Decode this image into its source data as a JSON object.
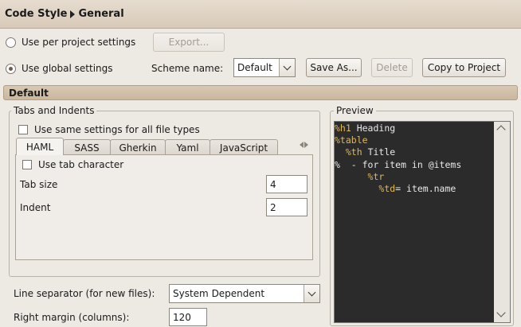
{
  "header": {
    "crumb_parent": "Code Style",
    "crumb_current": "General"
  },
  "scope": {
    "per_project_label": "Use per project settings",
    "global_label": "Use global settings",
    "export_label": "Export...",
    "scheme_label": "Scheme name:",
    "scheme_value": "Default",
    "save_as_label": "Save As...",
    "delete_label": "Delete",
    "copy_label": "Copy to Project"
  },
  "section": {
    "title": "Default"
  },
  "tabs_indents": {
    "title": "Tabs and Indents",
    "same_settings_label": "Use same settings for all file types",
    "tabs": [
      "HAML",
      "SASS",
      "Gherkin",
      "Yaml",
      "JavaScript"
    ],
    "use_tab_label": "Use tab character",
    "tab_size_label": "Tab size",
    "tab_size_value": "4",
    "indent_label": "Indent",
    "indent_value": "2"
  },
  "line_separator": {
    "label": "Line separator (for new files):",
    "value": "System Dependent"
  },
  "right_margin": {
    "label": "Right margin (columns):",
    "value": "120"
  },
  "preview": {
    "title": "Preview",
    "lines": [
      {
        "kw": "%h1",
        "text": " Heading",
        "indent": ""
      },
      {
        "kw": "%table",
        "text": "",
        "indent": ""
      },
      {
        "kw": "%th",
        "text": " Title",
        "indent": "  "
      },
      {
        "kw": "",
        "text": "%  - for item in @items",
        "indent": ""
      },
      {
        "kw": "%tr",
        "text": "",
        "indent": "      "
      },
      {
        "kw": "%td",
        "text": "= item.name",
        "indent": "        "
      }
    ]
  },
  "colors": {
    "accent": "#cbb79d",
    "code_bg": "#2b2b2b",
    "code_kw": "#e0b85a"
  }
}
